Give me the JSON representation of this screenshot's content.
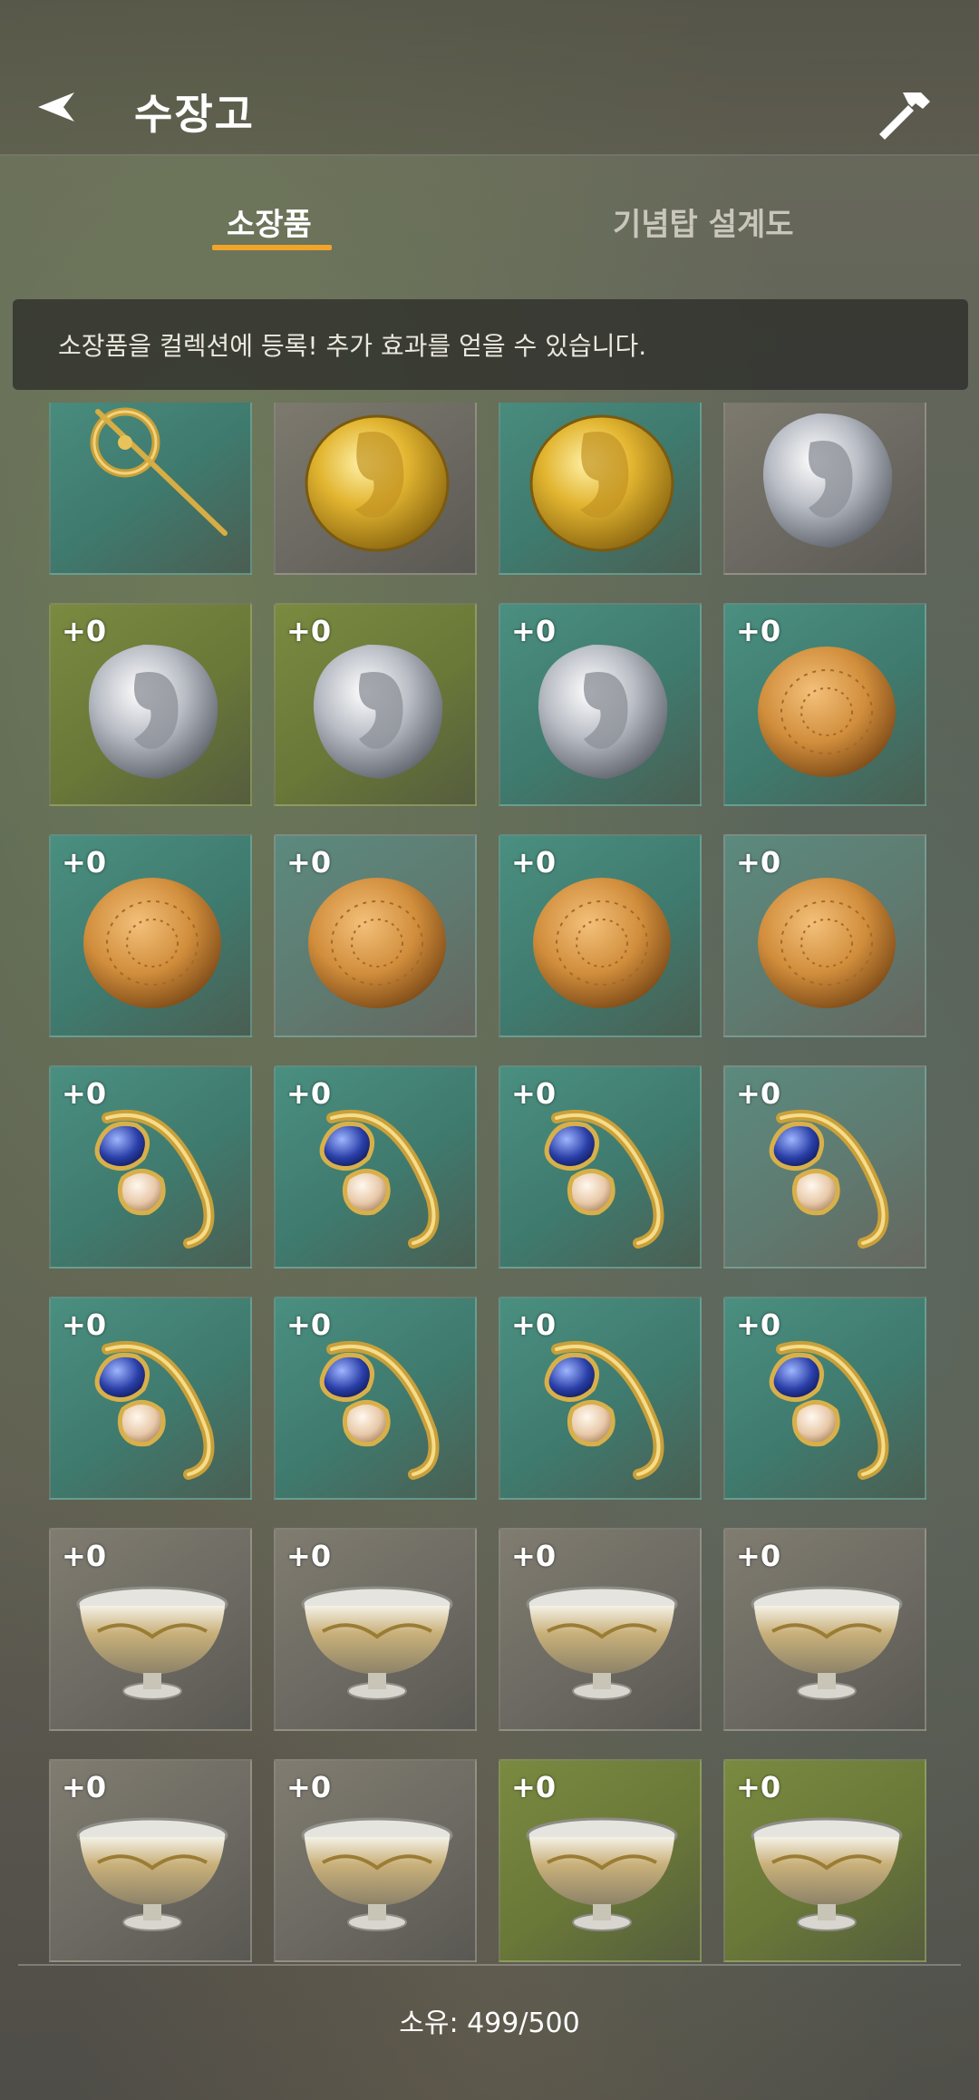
{
  "header": {
    "title": "수장고",
    "back_icon": "back-arrow-icon",
    "action_icon": "hammer-icon"
  },
  "tabs": [
    {
      "label": "소장품",
      "active": true
    },
    {
      "label": "기념탑 설계도",
      "active": false
    }
  ],
  "notice": "소장품을 컬렉션에 등록! 추가 효과를 얻을 수 있습니다.",
  "colors": {
    "accent": "#f0a52a",
    "teal_tile": "#4a8f80",
    "olive_tile": "#7a8a40",
    "grey_tile": "#807c70"
  },
  "items": [
    {
      "icon": "brooch-icon",
      "bg": "teal",
      "badge": ""
    },
    {
      "icon": "gold-coin-icon",
      "bg": "grey",
      "badge": ""
    },
    {
      "icon": "gold-coin-icon",
      "bg": "teal",
      "badge": ""
    },
    {
      "icon": "silver-coin-icon",
      "bg": "grey",
      "badge": ""
    },
    {
      "icon": "silver-coin-icon",
      "bg": "olive",
      "badge": "+0"
    },
    {
      "icon": "silver-coin-icon",
      "bg": "olive",
      "badge": "+0"
    },
    {
      "icon": "silver-coin-icon",
      "bg": "teal",
      "badge": "+0"
    },
    {
      "icon": "clay-disc-icon",
      "bg": "teal",
      "badge": "+0"
    },
    {
      "icon": "clay-disc-icon",
      "bg": "teal",
      "badge": "+0"
    },
    {
      "icon": "clay-disc-icon",
      "bg": "tealgrey",
      "badge": "+0"
    },
    {
      "icon": "clay-disc-icon",
      "bg": "teal",
      "badge": "+0"
    },
    {
      "icon": "clay-disc-icon",
      "bg": "tealgrey",
      "badge": "+0"
    },
    {
      "icon": "gem-ring-icon",
      "bg": "teal",
      "badge": "+0"
    },
    {
      "icon": "gem-ring-icon",
      "bg": "teal",
      "badge": "+0"
    },
    {
      "icon": "gem-ring-icon",
      "bg": "teal",
      "badge": "+0"
    },
    {
      "icon": "gem-ring-icon",
      "bg": "tealgrey",
      "badge": "+0"
    },
    {
      "icon": "gem-ring-icon",
      "bg": "teal",
      "badge": "+0"
    },
    {
      "icon": "gem-ring-icon",
      "bg": "teal",
      "badge": "+0"
    },
    {
      "icon": "gem-ring-icon",
      "bg": "teal",
      "badge": "+0"
    },
    {
      "icon": "gem-ring-icon",
      "bg": "teal",
      "badge": "+0"
    },
    {
      "icon": "silver-cup-icon",
      "bg": "grey",
      "badge": "+0"
    },
    {
      "icon": "silver-cup-icon",
      "bg": "grey",
      "badge": "+0"
    },
    {
      "icon": "silver-cup-icon",
      "bg": "grey",
      "badge": "+0"
    },
    {
      "icon": "silver-cup-icon",
      "bg": "grey",
      "badge": "+0"
    },
    {
      "icon": "silver-cup-icon",
      "bg": "grey",
      "badge": "+0"
    },
    {
      "icon": "silver-cup-icon",
      "bg": "grey",
      "badge": "+0"
    },
    {
      "icon": "silver-cup-icon",
      "bg": "olive",
      "badge": "+0"
    },
    {
      "icon": "silver-cup-icon",
      "bg": "olive",
      "badge": "+0"
    }
  ],
  "footer": {
    "owned_label": "소유: 499/500"
  }
}
